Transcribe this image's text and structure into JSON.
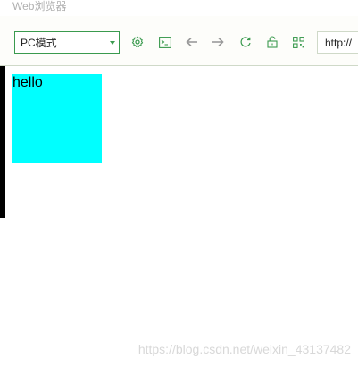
{
  "window": {
    "title": "Web浏览器"
  },
  "toolbar": {
    "mode_select": {
      "value": "PC模式"
    },
    "icons": [
      "gear-icon",
      "terminal-icon",
      "arrow-left-icon",
      "arrow-right-icon",
      "refresh-icon",
      "lock-icon",
      "qr-code-icon"
    ],
    "url": "http://"
  },
  "content": {
    "box_text": "hello",
    "box_color": "#00ffff"
  },
  "watermark": "https://blog.csdn.net/weixin_43137482",
  "colors": {
    "accent": "#3a9a4e",
    "muted_icon": "#9a9a9a"
  }
}
